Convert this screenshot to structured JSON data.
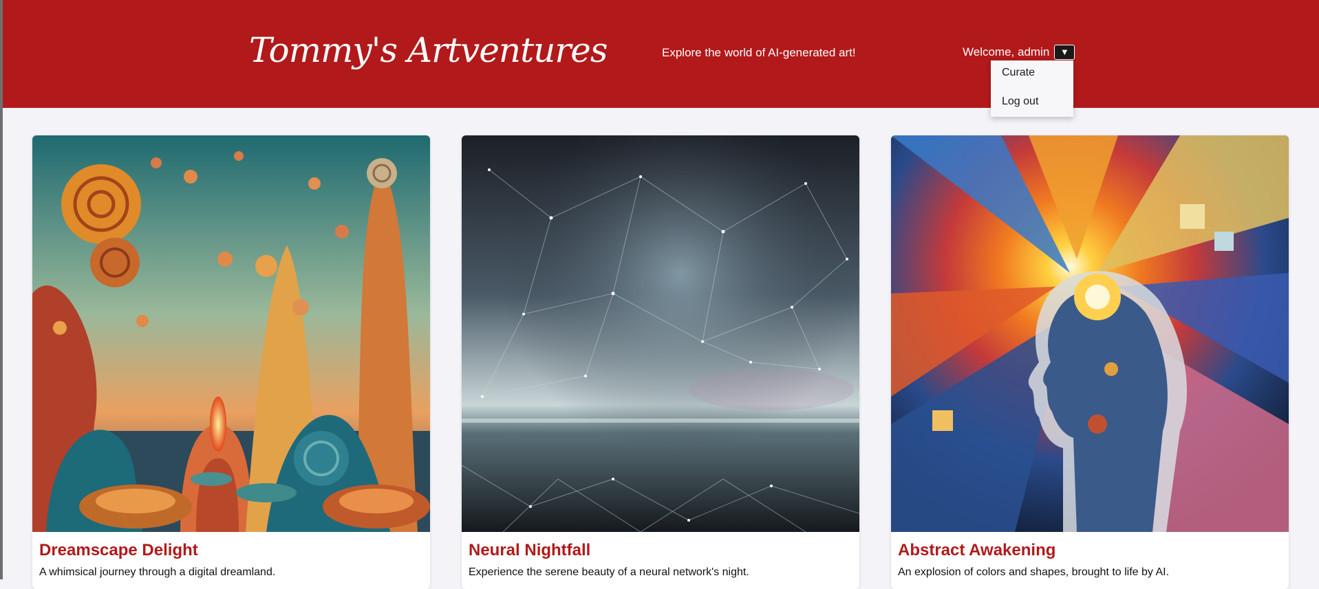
{
  "header": {
    "logo": "Tommy's Artventures",
    "tagline": "Explore the world of AI-generated art!",
    "welcome": "Welcome, admin",
    "dropdown_icon": "▼"
  },
  "menu": {
    "items": [
      "Curate",
      "Log out"
    ]
  },
  "gallery": [
    {
      "title": "Dreamscape Delight",
      "description": "A whimsical journey through a digital dreamland."
    },
    {
      "title": "Neural Nightfall",
      "description": "Experience the serene beauty of a neural network's night."
    },
    {
      "title": "Abstract Awakening",
      "description": "An explosion of colors and shapes, brought to life by AI."
    }
  ],
  "colors": {
    "brand": "#b2191a",
    "background": "#f3f3f8"
  }
}
